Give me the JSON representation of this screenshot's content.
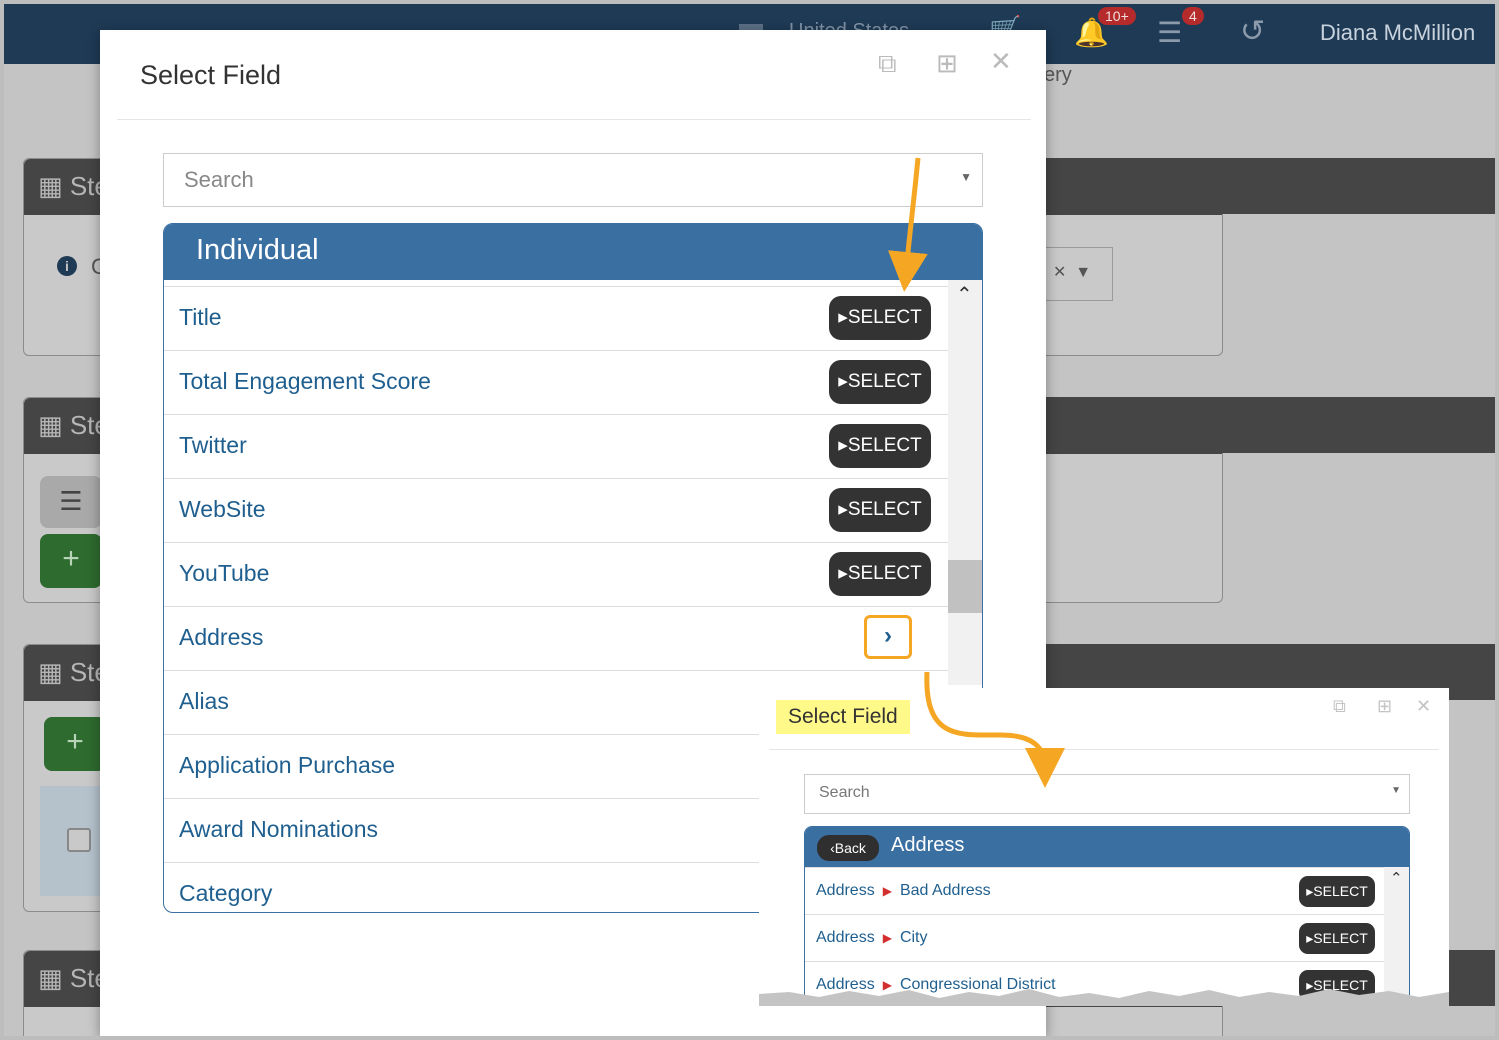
{
  "background": {
    "country": "United States",
    "cart_count_badge": "",
    "notifications_badge": "10+",
    "tasks_badge": "4",
    "user_name": "Diana McMillion",
    "partial_text": "ery",
    "panel_prefix": "Ste",
    "info_letter": "C"
  },
  "modal": {
    "title": "Select Field",
    "search_placeholder": "Search",
    "panel_title": "Individual",
    "rows": [
      {
        "label": "Title",
        "action": "SELECT"
      },
      {
        "label": "Total Engagement Score",
        "action": "SELECT"
      },
      {
        "label": "Twitter",
        "action": "SELECT"
      },
      {
        "label": "WebSite",
        "action": "SELECT"
      },
      {
        "label": "YouTube",
        "action": "SELECT"
      },
      {
        "label": "Address",
        "action": ""
      },
      {
        "label": "Alias",
        "action": ""
      },
      {
        "label": "Application Purchase",
        "action": ""
      },
      {
        "label": "Award Nominations",
        "action": ""
      },
      {
        "label": "Category",
        "action": ""
      }
    ]
  },
  "inset": {
    "title": "Select Field",
    "search_placeholder": "Search",
    "back_label": "Back",
    "panel_title": "Address",
    "rows": [
      {
        "parent": "Address",
        "child": "Bad Address",
        "action": "SELECT"
      },
      {
        "parent": "Address",
        "child": "City",
        "action": "SELECT"
      },
      {
        "parent": "Address",
        "child": "Congressional District",
        "action": "SELECT"
      }
    ]
  },
  "colors": {
    "header_blue": "#3a6fa2",
    "link_blue": "#1f5f8f",
    "select_button": "#333333",
    "highlight_orange": "#f5a623",
    "title_highlight": "#fff98a",
    "topbar": "#1f3a55"
  }
}
